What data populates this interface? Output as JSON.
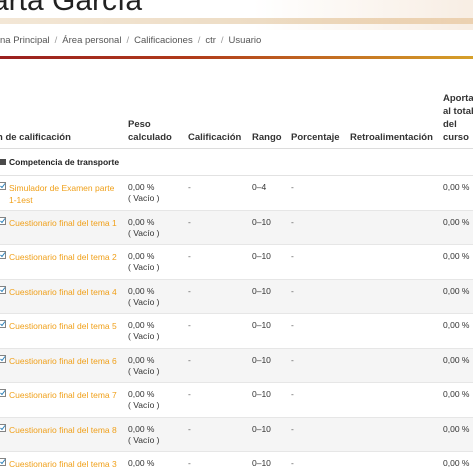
{
  "header": {
    "title": "arta García",
    "breadcrumb": [
      "na Principal",
      "Área personal",
      "Calificaciones",
      "ctr",
      "Usuario"
    ]
  },
  "table": {
    "columns": {
      "name": "n de calificación",
      "peso": "Peso calculado",
      "calif": "Calificación",
      "rango": "Rango",
      "porc": "Porcentaje",
      "retro": "Retroalimentación",
      "aporta": "Aporta al total del curso"
    },
    "category": "Competencia de transporte",
    "rows": [
      {
        "name": "Simulador de Examen parte 1-1est",
        "peso": "0,00 %",
        "vacio": "( Vacío )",
        "calif": "-",
        "rango": "0–4",
        "porc": "-",
        "aporta": "0,00 %"
      },
      {
        "name": "Cuestionario final del tema 1",
        "peso": "0,00 %",
        "vacio": "( Vacío )",
        "calif": "-",
        "rango": "0–10",
        "porc": "-",
        "aporta": "0,00 %"
      },
      {
        "name": "Cuestionario final del tema 2",
        "peso": "0,00 %",
        "vacio": "( Vacío )",
        "calif": "-",
        "rango": "0–10",
        "porc": "-",
        "aporta": "0,00 %"
      },
      {
        "name": "Cuestionario final del tema 4",
        "peso": "0,00 %",
        "vacio": "( Vacío )",
        "calif": "-",
        "rango": "0–10",
        "porc": "-",
        "aporta": "0,00 %"
      },
      {
        "name": "Cuestionario final del tema 5",
        "peso": "0,00 %",
        "vacio": "( Vacío )",
        "calif": "-",
        "rango": "0–10",
        "porc": "-",
        "aporta": "0,00 %"
      },
      {
        "name": "Cuestionario final del tema 6",
        "peso": "0,00 %",
        "vacio": "( Vacío )",
        "calif": "-",
        "rango": "0–10",
        "porc": "-",
        "aporta": "0,00 %"
      },
      {
        "name": "Cuestionario final del tema 7",
        "peso": "0,00 %",
        "vacio": "( Vacío )",
        "calif": "-",
        "rango": "0–10",
        "porc": "-",
        "aporta": "0,00 %"
      },
      {
        "name": "Cuestionario final del tema 8",
        "peso": "0,00 %",
        "vacio": "( Vacío )",
        "calif": "-",
        "rango": "0–10",
        "porc": "-",
        "aporta": "0,00 %"
      },
      {
        "name": "Cuestionario final del tema 3",
        "peso": "0,00 %",
        "vacio": "",
        "calif": "-",
        "rango": "0–10",
        "porc": "-",
        "aporta": "0,00 %"
      }
    ]
  }
}
